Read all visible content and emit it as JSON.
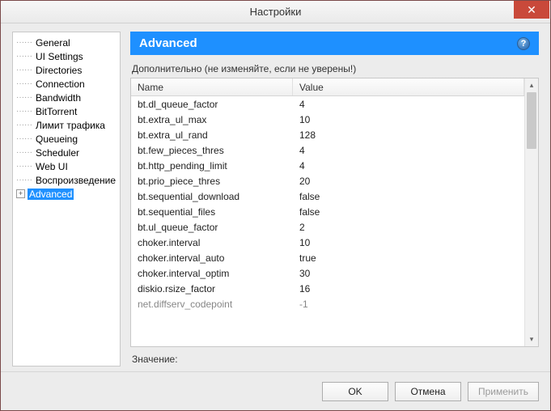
{
  "window": {
    "title": "Настройки"
  },
  "sidebar": {
    "items": [
      {
        "label": "General"
      },
      {
        "label": "UI Settings"
      },
      {
        "label": "Directories"
      },
      {
        "label": "Connection"
      },
      {
        "label": "Bandwidth"
      },
      {
        "label": "BitTorrent"
      },
      {
        "label": "Лимит трафика"
      },
      {
        "label": "Queueing"
      },
      {
        "label": "Scheduler"
      },
      {
        "label": "Web UI"
      },
      {
        "label": "Воспроизведение"
      },
      {
        "label": "Advanced",
        "selected": true,
        "expandable": true
      }
    ]
  },
  "section": {
    "heading": "Advanced",
    "subtitle": "Дополнительно (не изменяйте, если не уверены!)",
    "columns": {
      "name": "Name",
      "value": "Value"
    },
    "value_label": "Значение:"
  },
  "settings": [
    {
      "name": "bt.dl_queue_factor",
      "value": "4"
    },
    {
      "name": "bt.extra_ul_max",
      "value": "10"
    },
    {
      "name": "bt.extra_ul_rand",
      "value": "128"
    },
    {
      "name": "bt.few_pieces_thres",
      "value": "4"
    },
    {
      "name": "bt.http_pending_limit",
      "value": "4"
    },
    {
      "name": "bt.prio_piece_thres",
      "value": "20"
    },
    {
      "name": "bt.sequential_download",
      "value": "false"
    },
    {
      "name": "bt.sequential_files",
      "value": "false"
    },
    {
      "name": "bt.ul_queue_factor",
      "value": "2"
    },
    {
      "name": "choker.interval",
      "value": "10"
    },
    {
      "name": "choker.interval_auto",
      "value": "true"
    },
    {
      "name": "choker.interval_optim",
      "value": "30"
    },
    {
      "name": "diskio.rsize_factor",
      "value": "16"
    },
    {
      "name": "net.diffserv_codepoint",
      "value": "-1",
      "cut": true
    }
  ],
  "buttons": {
    "ok": "OK",
    "cancel": "Отмена",
    "apply": "Применить"
  }
}
